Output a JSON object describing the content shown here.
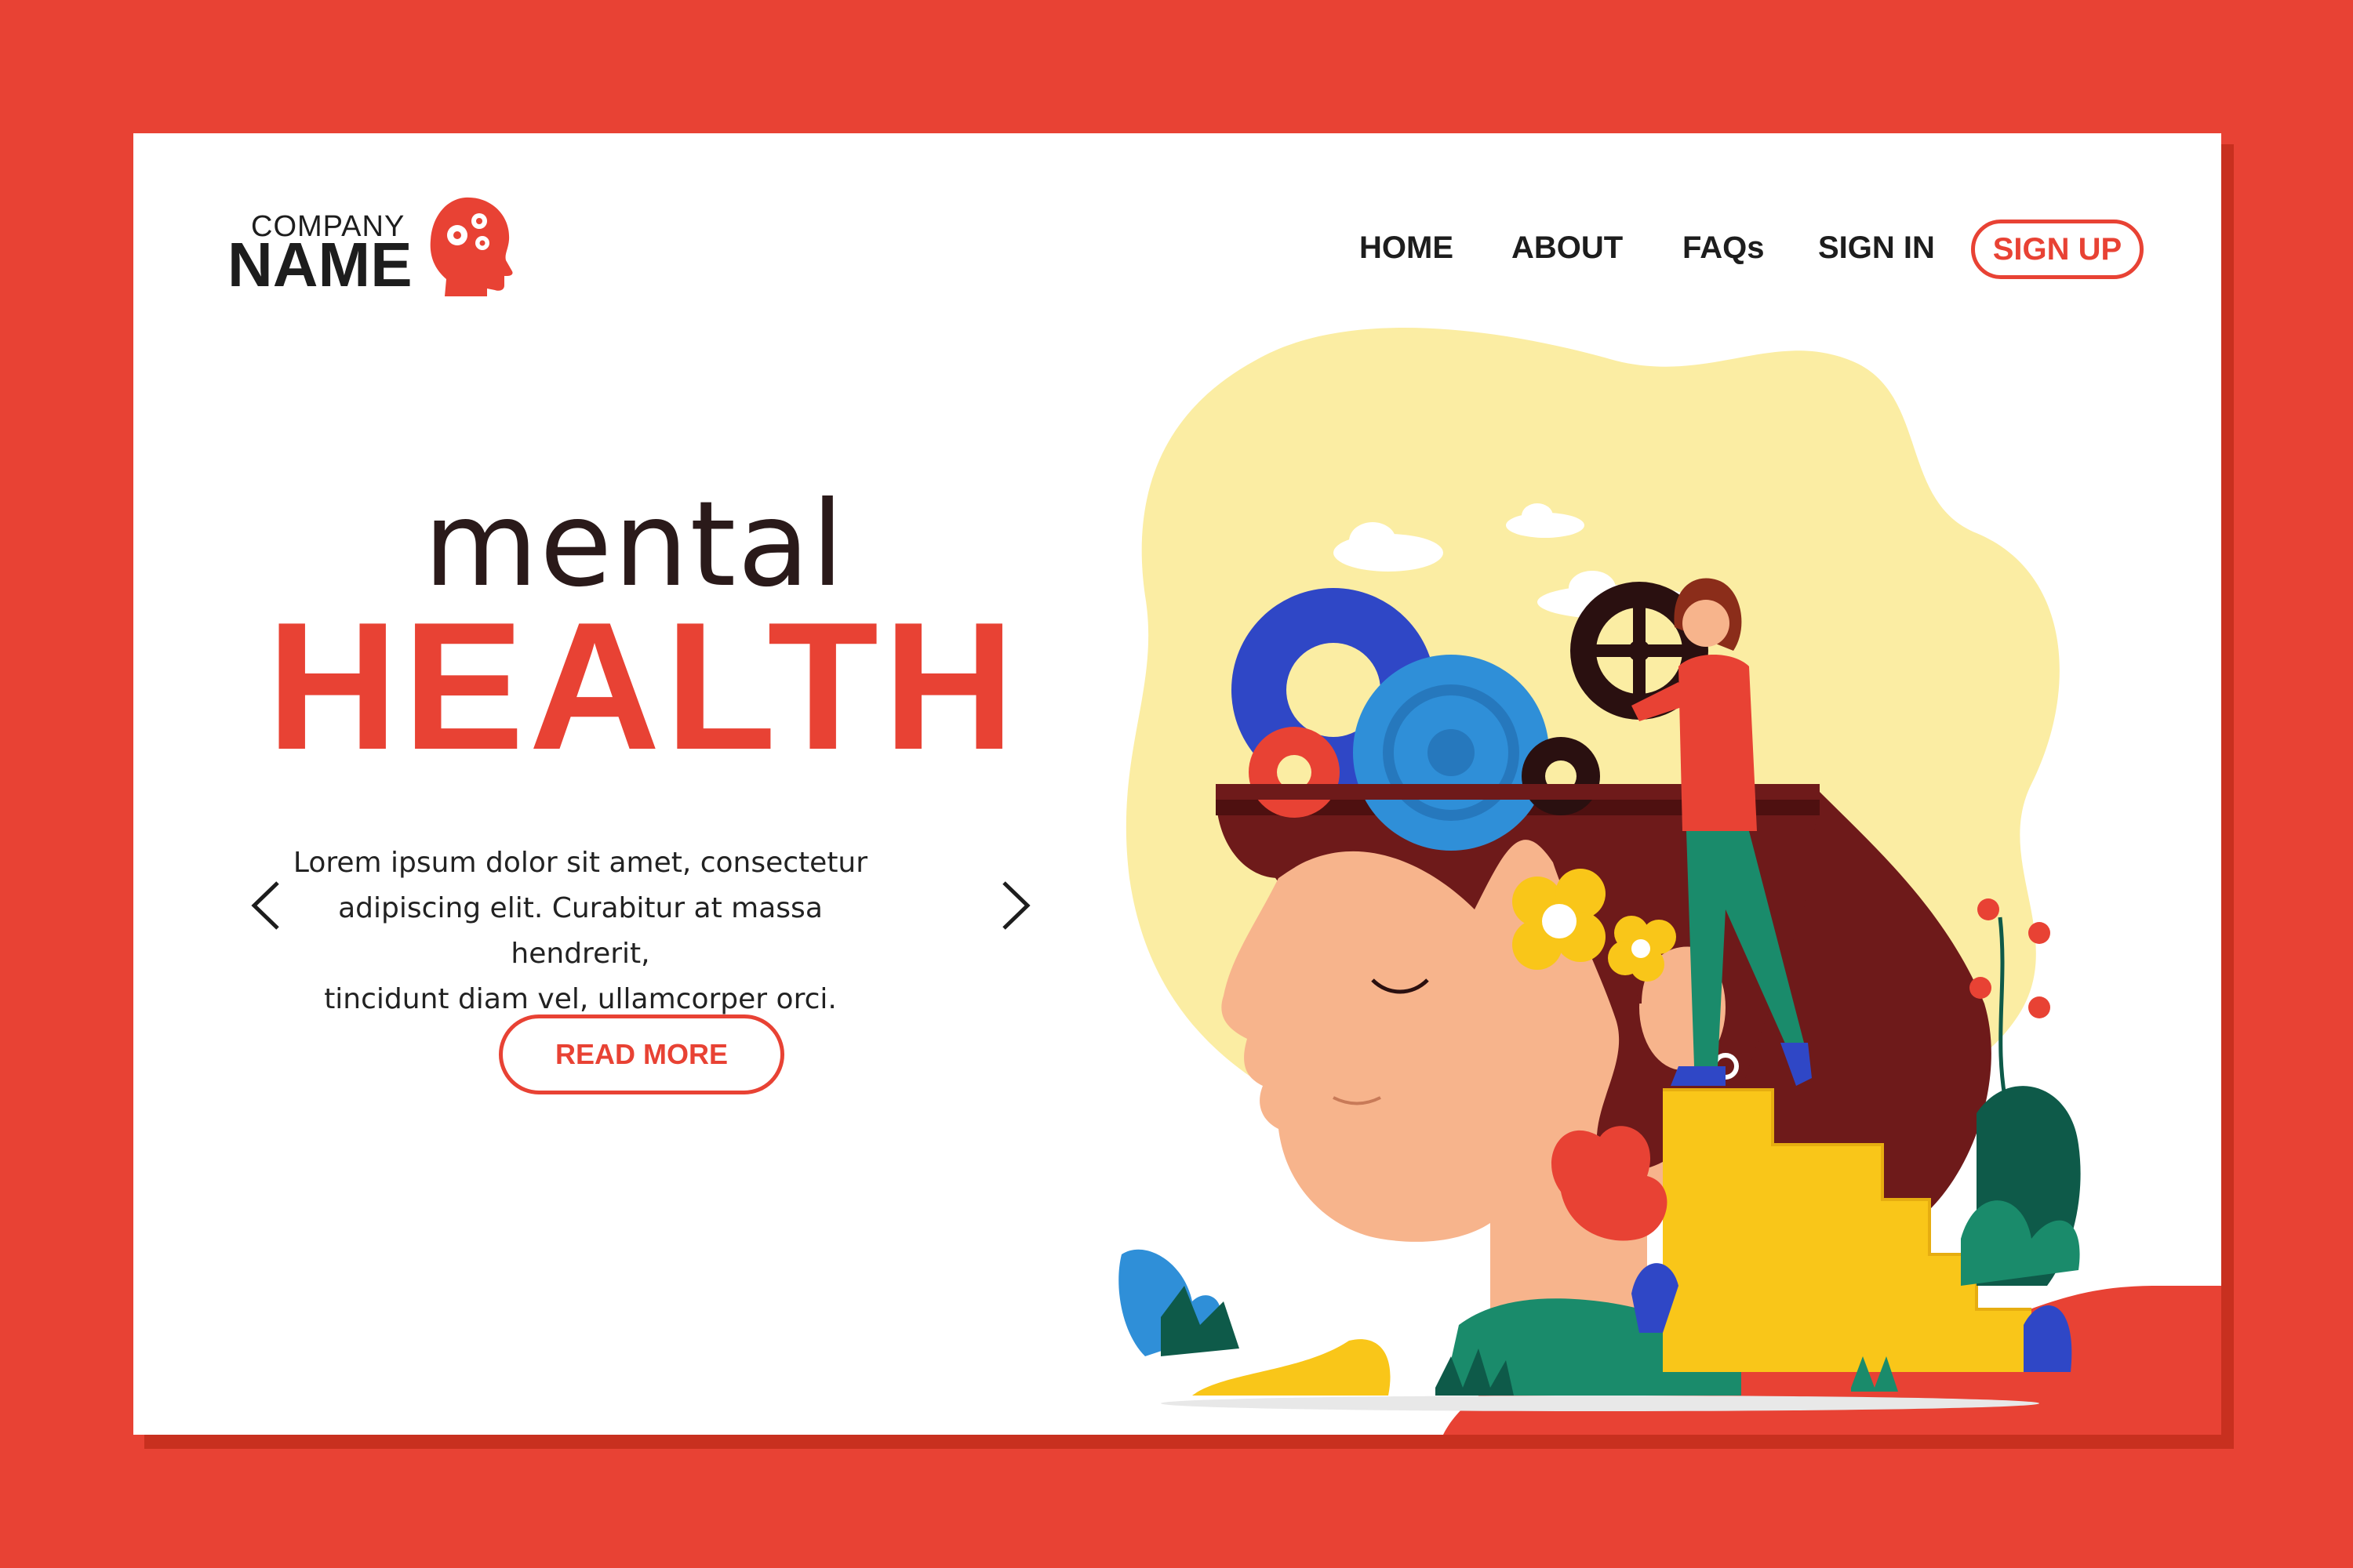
{
  "logo": {
    "company": "COMPANY",
    "name": "NAME",
    "icon": "head-gears-icon"
  },
  "nav": {
    "items": [
      {
        "label": "HOME"
      },
      {
        "label": "ABOUT"
      },
      {
        "label": "FAQs"
      },
      {
        "label": "SIGN IN"
      }
    ],
    "signup_label": "SIGN UP"
  },
  "hero": {
    "title_top": "mental",
    "title_bottom": "HEALTH",
    "body_lines": [
      "Lorem ipsum dolor sit amet, consectetur",
      "adipiscing elit. Curabitur at massa hendrerit,",
      "tincidunt diam vel, ullamcorper orci."
    ],
    "read_more_label": "READ MORE",
    "prev_icon": "chevron-left-icon",
    "next_icon": "chevron-right-icon"
  },
  "colors": {
    "accent": "#e84234",
    "accent_dark": "#c8301f",
    "text_dark": "#1d1d1d",
    "card": "#ffffff",
    "blob": "#fbeda3",
    "hair": "#6e1a1a",
    "skin": "#f7b48c",
    "gear_blue": "#2f47c6",
    "gear_light_blue": "#2f8fd8",
    "gear_dark": "#2a1010",
    "stairs": "#f9c619",
    "leaf_green": "#1a8b6b",
    "leaf_dark": "#0e5a49"
  }
}
